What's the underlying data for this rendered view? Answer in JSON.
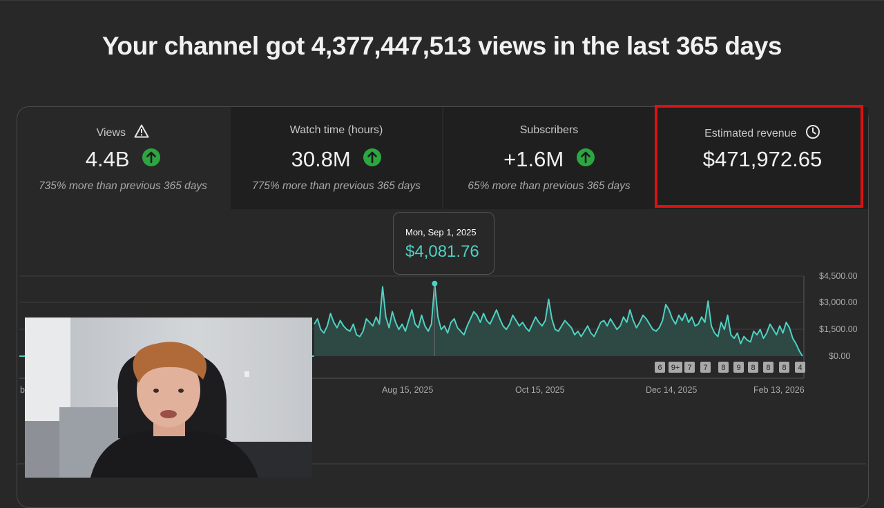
{
  "headline": "Your channel got 4,377,447,513 views in the last 365 days",
  "cards": [
    {
      "label": "Views",
      "icon": "warning-icon",
      "value": "4.4B",
      "trend": "up",
      "note": "735% more than previous 365 days"
    },
    {
      "label": "Watch time (hours)",
      "icon": "",
      "value": "30.8M",
      "trend": "up",
      "note": "775% more than previous 365 days"
    },
    {
      "label": "Subscribers",
      "icon": "",
      "value": "+1.6M",
      "trend": "up",
      "note": "65% more than previous 365 days"
    },
    {
      "label": "Estimated revenue",
      "icon": "clock-icon",
      "value": "$471,972.65",
      "trend": "",
      "note": ""
    }
  ],
  "tooltip": {
    "date": "Mon, Sep 1, 2025",
    "value": "$4,081.76"
  },
  "chart_data": {
    "type": "area",
    "y_ticks": [
      "$4,500.00",
      "$3,000.00",
      "$1,500.00",
      "$0.00"
    ],
    "ylim": [
      0,
      4500
    ],
    "x_ticks": [
      "Aug 15, 2025",
      "Oct 15, 2025",
      "Dec 14, 2025",
      "Feb 13, 2026"
    ],
    "highlight_point": {
      "x": "Sep 1, 2025",
      "y": 4081.76
    },
    "values": [
      1800,
      2100,
      1500,
      1300,
      1700,
      2400,
      1900,
      1600,
      2000,
      1700,
      1500,
      1400,
      1800,
      1200,
      1100,
      1400,
      2100,
      1900,
      1700,
      2200,
      1800,
      3900,
      2200,
      1600,
      2500,
      1900,
      1500,
      1800,
      1400,
      2000,
      2600,
      1800,
      1600,
      2300,
      1700,
      1400,
      1800,
      4081,
      2200,
      1500,
      1700,
      1300,
      1900,
      2100,
      1600,
      1400,
      1200,
      1700,
      2100,
      2500,
      2300,
      1900,
      2400,
      2000,
      1800,
      2200,
      2600,
      2100,
      1700,
      1500,
      1800,
      2300,
      2000,
      1700,
      1900,
      1600,
      1400,
      1800,
      2200,
      1900,
      1700,
      2000,
      3200,
      2100,
      1500,
      1400,
      1700,
      2000,
      1800,
      1600,
      1200,
      1400,
      1100,
      1400,
      1700,
      1300,
      1100,
      1500,
      1900,
      2000,
      1700,
      2100,
      1800,
      1500,
      1700,
      2200,
      1900,
      2600,
      2000,
      1600,
      1900,
      2300,
      2100,
      1800,
      1500,
      1400,
      1600,
      2000,
      2900,
      2600,
      2100,
      1800,
      2300,
      2000,
      2400,
      1900,
      2200,
      1700,
      1800,
      2200,
      1900,
      3100,
      1700,
      1300,
      1100,
      1900,
      1500,
      2300,
      1200,
      1000,
      1300,
      700,
      1100,
      900,
      800,
      1400,
      1200,
      1500,
      1000,
      1300,
      1800,
      1500,
      1200,
      1700,
      1300,
      1900,
      1600,
      1000,
      700,
      300,
      0
    ]
  },
  "badges": [
    "6",
    "9+",
    "7",
    "7",
    "8",
    "9",
    "8",
    "8",
    "8",
    "4"
  ],
  "edge_labels": {
    "left_tick_fragment": "b"
  }
}
